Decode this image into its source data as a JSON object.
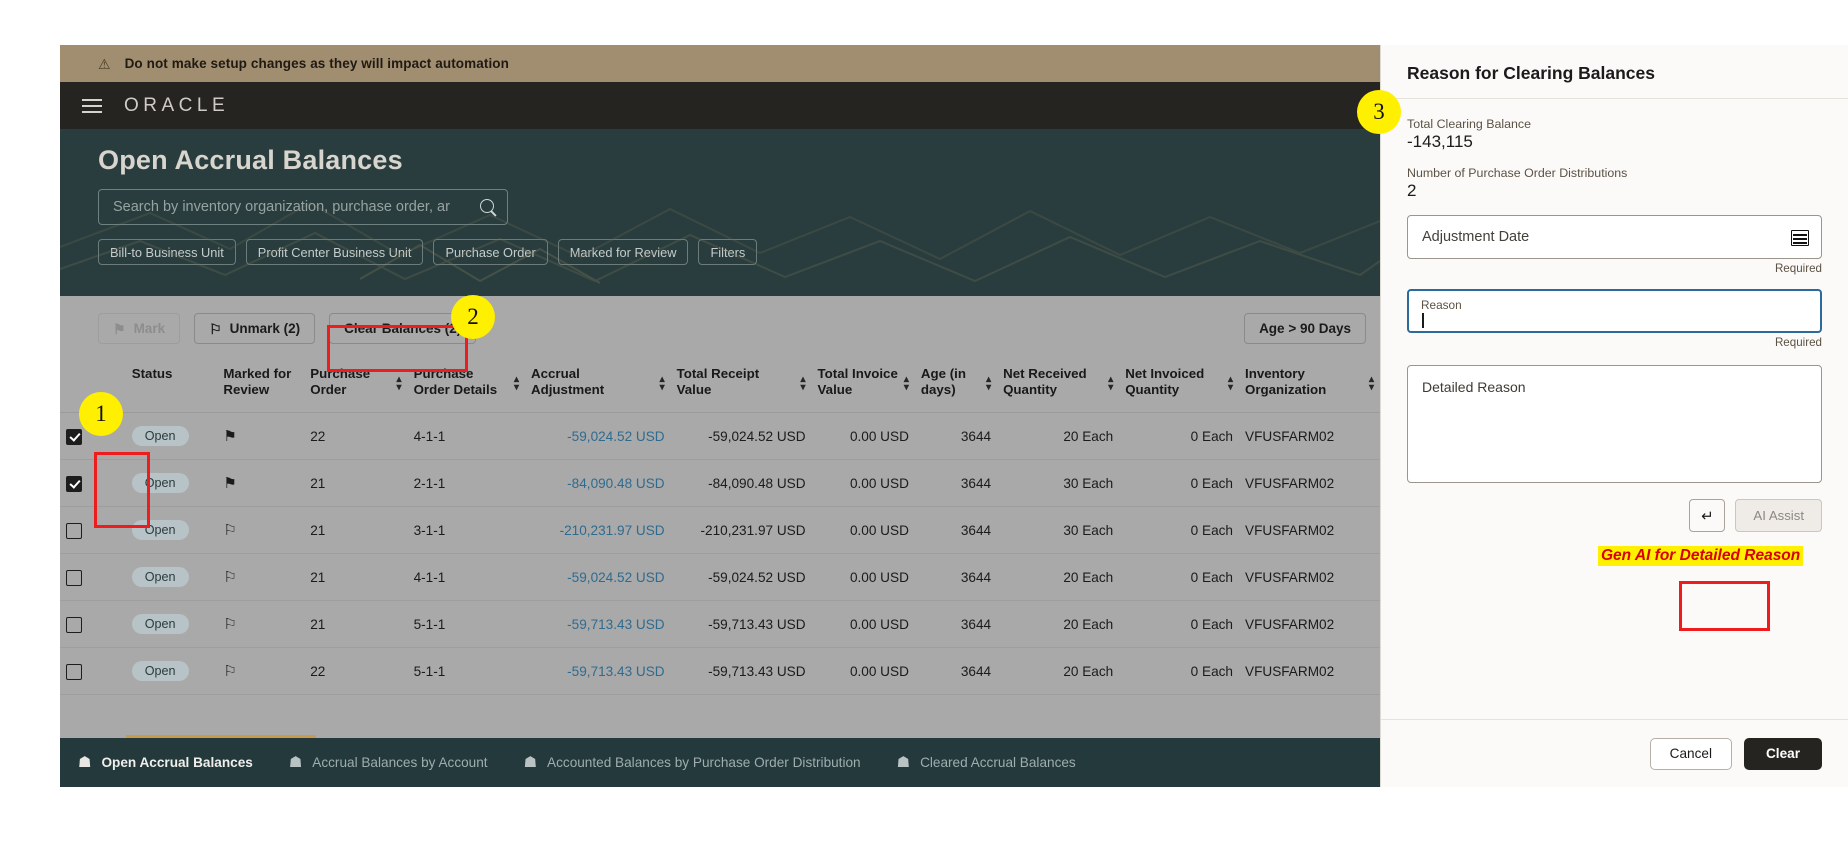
{
  "banner": {
    "text": "Do not make setup changes as they will impact automation",
    "icon": "warning-triangle-icon"
  },
  "global_header": {
    "brand": "ORACLE",
    "menu_icon": "hamburger-menu-icon"
  },
  "hero": {
    "title": "Open Accrual Balances",
    "search": {
      "value": "",
      "placeholder": "Search by inventory organization, purchase order, ar",
      "icon": "search-icon"
    },
    "filter_chips": [
      "Bill-to Business Unit",
      "Profit Center Business Unit",
      "Purchase Order",
      "Marked for Review",
      "Filters"
    ]
  },
  "toolbar": {
    "mark_label": "Mark",
    "unmark_label": "Unmark (2)",
    "clear_balances_label": "Clear Balances (2)",
    "age_filter_label": "Age > 90 Days"
  },
  "table": {
    "columns": [
      {
        "key": "select",
        "label": "",
        "sortable": false
      },
      {
        "key": "status",
        "label": "Status",
        "sortable": false
      },
      {
        "key": "marked",
        "label": "Marked for Review",
        "sortable": false
      },
      {
        "key": "po",
        "label": "Purchase Order",
        "sortable": true
      },
      {
        "key": "pod",
        "label": "Purchase Order Details",
        "sortable": true
      },
      {
        "key": "accrual",
        "label": "Accrual Adjustment",
        "sortable": true
      },
      {
        "key": "receipt",
        "label": "Total Receipt Value",
        "sortable": true
      },
      {
        "key": "invoice",
        "label": "Total Invoice Value",
        "sortable": true
      },
      {
        "key": "age",
        "label": "Age (in days)",
        "sortable": true
      },
      {
        "key": "netrec",
        "label": "Net Received Quantity",
        "sortable": true
      },
      {
        "key": "netinv",
        "label": "Net Invoiced Quantity",
        "sortable": true
      },
      {
        "key": "inv",
        "label": "Inventory Organization",
        "sortable": true
      }
    ],
    "rows": [
      {
        "selected": true,
        "status": "Open",
        "marked": true,
        "po": "22",
        "pod": "4-1-1",
        "accrual": "-59,024.52 USD",
        "receipt": "-59,024.52 USD",
        "invoice": "0.00 USD",
        "age": "3644",
        "netrec": "20 Each",
        "netinv": "0 Each",
        "inv": "VFUSFARM02"
      },
      {
        "selected": true,
        "status": "Open",
        "marked": true,
        "po": "21",
        "pod": "2-1-1",
        "accrual": "-84,090.48 USD",
        "receipt": "-84,090.48 USD",
        "invoice": "0.00 USD",
        "age": "3644",
        "netrec": "30 Each",
        "netinv": "0 Each",
        "inv": "VFUSFARM02"
      },
      {
        "selected": false,
        "status": "Open",
        "marked": false,
        "po": "21",
        "pod": "3-1-1",
        "accrual": "-210,231.97 USD",
        "receipt": "-210,231.97 USD",
        "invoice": "0.00 USD",
        "age": "3644",
        "netrec": "30 Each",
        "netinv": "0 Each",
        "inv": "VFUSFARM02"
      },
      {
        "selected": false,
        "status": "Open",
        "marked": false,
        "po": "21",
        "pod": "4-1-1",
        "accrual": "-59,024.52 USD",
        "receipt": "-59,024.52 USD",
        "invoice": "0.00 USD",
        "age": "3644",
        "netrec": "20 Each",
        "netinv": "0 Each",
        "inv": "VFUSFARM02"
      },
      {
        "selected": false,
        "status": "Open",
        "marked": false,
        "po": "21",
        "pod": "5-1-1",
        "accrual": "-59,713.43 USD",
        "receipt": "-59,713.43 USD",
        "invoice": "0.00 USD",
        "age": "3644",
        "netrec": "20 Each",
        "netinv": "0 Each",
        "inv": "VFUSFARM02"
      },
      {
        "selected": false,
        "status": "Open",
        "marked": false,
        "po": "22",
        "pod": "5-1-1",
        "accrual": "-59,713.43 USD",
        "receipt": "-59,713.43 USD",
        "invoice": "0.00 USD",
        "age": "3644",
        "netrec": "20 Each",
        "netinv": "0 Each",
        "inv": "VFUSFARM02"
      }
    ]
  },
  "footer_nav": [
    {
      "label": "Open Accrual Balances",
      "active": true
    },
    {
      "label": "Accrual Balances by Account",
      "active": false
    },
    {
      "label": "Accounted Balances by Purchase Order Distribution",
      "active": false
    },
    {
      "label": "Cleared Accrual Balances",
      "active": false
    }
  ],
  "side_panel": {
    "title": "Reason for Clearing Balances",
    "total_clearing_balance_label": "Total Clearing Balance",
    "total_clearing_balance_value": "-143,115",
    "po_distributions_label": "Number of Purchase Order Distributions",
    "po_distributions_value": "2",
    "adjustment_date": {
      "placeholder": "Adjustment Date",
      "value": "",
      "required_text": "Required",
      "icon": "calendar-icon"
    },
    "reason": {
      "label": "Reason",
      "value": "",
      "required_text": "Required"
    },
    "detailed_reason": {
      "placeholder": "Detailed Reason",
      "value": ""
    },
    "enter_button_glyph": "↵",
    "ai_assist_label": "AI Assist",
    "cancel_label": "Cancel",
    "clear_label": "Clear"
  },
  "annotations": {
    "badge_1": "1",
    "badge_2": "2",
    "badge_3": "3",
    "genai_note": "Gen AI for Detailed Reason"
  },
  "colors": {
    "banner_bg": "#a18e71",
    "oracle_bg": "#262420",
    "hero_bg": "#293d3e",
    "grid_bg": "#a9a9a9",
    "link": "#2f6b8f",
    "annotation_red": "#ee1c1c",
    "annotation_yellow": "#ffef00",
    "clear_button_bg": "#262420"
  }
}
